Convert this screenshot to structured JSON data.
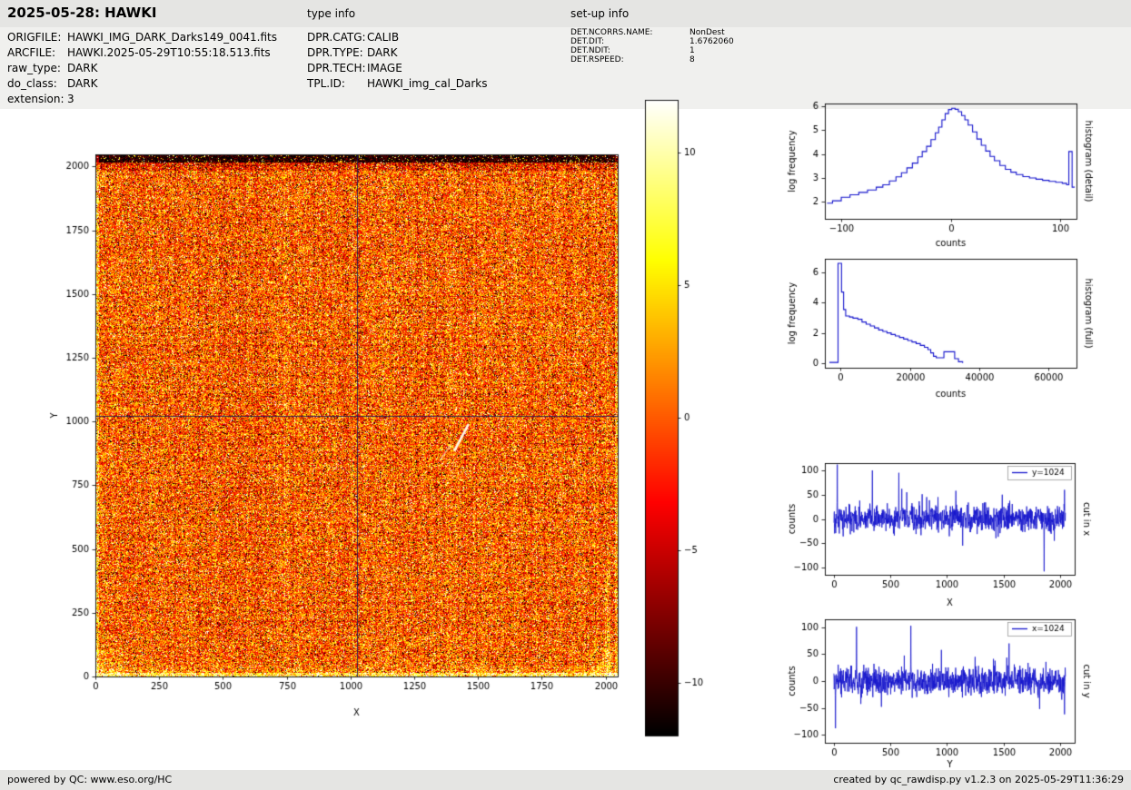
{
  "colors": {
    "page_bg": "#ffffff",
    "band_bg": "#f0f0ee",
    "bar_bg": "#e5e5e3",
    "figure_bg": "#ffffff",
    "plot_line": "#1414cc",
    "crosshair": "#14145a"
  },
  "header": {
    "title": "2025-05-28: HAWKI",
    "type_info_label": "type info",
    "setup_info_label": "set-up info"
  },
  "metadata": {
    "files": [
      {
        "label": "ORIGFILE:",
        "value": "HAWKI_IMG_DARK_Darks149_0041.fits"
      },
      {
        "label": "ARCFILE:",
        "value": "HAWKI.2025-05-29T10:55:18.513.fits"
      },
      {
        "label": "raw_type:",
        "value": "DARK"
      },
      {
        "label": "do_class:",
        "value": "DARK"
      },
      {
        "label": "extension:",
        "value": "3"
      }
    ],
    "dpr": [
      {
        "label": "DPR.CATG:",
        "value": "CALIB"
      },
      {
        "label": "DPR.TYPE:",
        "value": "DARK"
      },
      {
        "label": "DPR.TECH:",
        "value": "IMAGE"
      },
      {
        "label": "TPL.ID:",
        "value": "HAWKI_img_cal_Darks"
      }
    ],
    "det": [
      {
        "label": "DET.NCORRS.NAME:",
        "value": "NonDest"
      },
      {
        "label": "DET.DIT:",
        "value": "1.6762060"
      },
      {
        "label": "DET.NDIT:",
        "value": "1"
      },
      {
        "label": "DET.RSPEED:",
        "value": "8"
      }
    ]
  },
  "footer": {
    "left": "powered by QC: www.eso.org/HC",
    "right": "created by qc_rawdisp.py v1.2.3 on 2025-05-29T11:36:29"
  },
  "chart_data": [
    {
      "type": "heatmap",
      "name": "raw dark frame image",
      "xlabel": "X",
      "ylabel": "Y",
      "xlim": [
        0,
        2048
      ],
      "ylim": [
        0,
        2048
      ],
      "xticks": [
        0,
        250,
        500,
        750,
        1000,
        1250,
        1500,
        1750,
        2000
      ],
      "yticks": [
        0,
        250,
        500,
        750,
        1000,
        1250,
        1500,
        1750,
        2000
      ],
      "colormap": "hot",
      "vmin": -12,
      "vmax": 12,
      "colorbar_ticks": [
        10,
        5,
        0,
        -5,
        -10
      ],
      "crosshair_x": 1024,
      "crosshair_y": 1024,
      "noise_sigma": 4,
      "seed": 1234,
      "description": "2048x2048 HAWKI dark frame: orange mid-level gaussian noise with dense salt-and-pepper outliers, dark band along top edge, bright band along bottom edge, bright left/right edge columns, faint bright diagonal streak near (1440,950), dark cut crosshair lines at x=1024 and y=1024"
    },
    {
      "type": "line",
      "name": "histogram (detail)",
      "style": "steps",
      "xlabel": "counts",
      "ylabel": "log frequency",
      "right_label": "histogram (detail)",
      "xlim": [
        -115,
        115
      ],
      "ylim": [
        1.3,
        6.1
      ],
      "xticks": [
        -100,
        0,
        100
      ],
      "yticks": [
        2,
        3,
        4,
        5,
        6
      ],
      "points": [
        [
          -113,
          1.95
        ],
        [
          -108,
          2.05
        ],
        [
          -100,
          2.2
        ],
        [
          -92,
          2.3
        ],
        [
          -84,
          2.4
        ],
        [
          -76,
          2.5
        ],
        [
          -68,
          2.62
        ],
        [
          -62,
          2.72
        ],
        [
          -56,
          2.88
        ],
        [
          -50,
          3.05
        ],
        [
          -45,
          3.22
        ],
        [
          -40,
          3.42
        ],
        [
          -35,
          3.62
        ],
        [
          -30,
          3.88
        ],
        [
          -26,
          4.1
        ],
        [
          -22,
          4.32
        ],
        [
          -18,
          4.6
        ],
        [
          -14,
          4.88
        ],
        [
          -11,
          5.12
        ],
        [
          -8,
          5.42
        ],
        [
          -5,
          5.68
        ],
        [
          -2,
          5.85
        ],
        [
          1,
          5.9
        ],
        [
          4,
          5.86
        ],
        [
          7,
          5.76
        ],
        [
          10,
          5.6
        ],
        [
          13,
          5.42
        ],
        [
          16,
          5.2
        ],
        [
          20,
          4.92
        ],
        [
          24,
          4.62
        ],
        [
          28,
          4.36
        ],
        [
          32,
          4.12
        ],
        [
          36,
          3.9
        ],
        [
          40,
          3.72
        ],
        [
          45,
          3.52
        ],
        [
          50,
          3.36
        ],
        [
          55,
          3.24
        ],
        [
          60,
          3.14
        ],
        [
          66,
          3.06
        ],
        [
          72,
          3.0
        ],
        [
          78,
          2.95
        ],
        [
          84,
          2.9
        ],
        [
          90,
          2.86
        ],
        [
          96,
          2.82
        ],
        [
          102,
          2.78
        ],
        [
          106,
          2.72
        ],
        [
          108,
          4.1
        ],
        [
          110,
          4.1
        ],
        [
          111,
          2.62
        ],
        [
          113,
          2.6
        ]
      ]
    },
    {
      "type": "line",
      "name": "histogram (full)",
      "style": "steps",
      "xlabel": "counts",
      "ylabel": "log frequency",
      "right_label": "histogram (full)",
      "xlim": [
        -4500,
        68000
      ],
      "ylim": [
        -0.3,
        6.9
      ],
      "xticks": [
        0,
        20000,
        40000,
        60000
      ],
      "yticks": [
        0,
        2,
        4,
        6
      ],
      "points": [
        [
          -3200,
          0.05
        ],
        [
          -700,
          0.05
        ],
        [
          -700,
          6.6
        ],
        [
          300,
          6.6
        ],
        [
          300,
          4.7
        ],
        [
          900,
          4.7
        ],
        [
          900,
          3.55
        ],
        [
          1500,
          3.55
        ],
        [
          1500,
          3.12
        ],
        [
          2600,
          3.05
        ],
        [
          3600,
          2.98
        ],
        [
          5000,
          2.9
        ],
        [
          6200,
          2.72
        ],
        [
          7400,
          2.58
        ],
        [
          8600,
          2.46
        ],
        [
          9800,
          2.33
        ],
        [
          11000,
          2.2
        ],
        [
          12200,
          2.1
        ],
        [
          13400,
          2.0
        ],
        [
          14600,
          1.9
        ],
        [
          15800,
          1.8
        ],
        [
          17000,
          1.7
        ],
        [
          18200,
          1.6
        ],
        [
          19400,
          1.5
        ],
        [
          20600,
          1.4
        ],
        [
          21800,
          1.3
        ],
        [
          23000,
          1.18
        ],
        [
          24200,
          1.05
        ],
        [
          25200,
          0.9
        ],
        [
          26000,
          0.68
        ],
        [
          26800,
          0.46
        ],
        [
          27600,
          0.36
        ],
        [
          29400,
          0.36
        ],
        [
          29800,
          0.76
        ],
        [
          32400,
          0.76
        ],
        [
          32900,
          0.3
        ],
        [
          34000,
          0.1
        ],
        [
          35200,
          0.02
        ]
      ]
    },
    {
      "type": "line",
      "name": "cut in x",
      "style": "noise",
      "legend": "y=1024",
      "xlabel": "X",
      "ylabel": "counts",
      "right_label": "cut in x",
      "xlim": [
        -80,
        2130
      ],
      "ylim": [
        -115,
        115
      ],
      "xticks": [
        0,
        500,
        1000,
        1500,
        2000
      ],
      "yticks": [
        -100,
        -50,
        0,
        50,
        100
      ],
      "noise_sigma": 13,
      "seed": 77,
      "n": 1024,
      "x_max": 2048,
      "spikes": [
        [
          30,
          112
        ],
        [
          340,
          100
        ],
        [
          575,
          95
        ],
        [
          600,
          62
        ],
        [
          645,
          55
        ],
        [
          820,
          45
        ],
        [
          1080,
          58
        ],
        [
          1140,
          -55
        ],
        [
          1490,
          50
        ],
        [
          1860,
          -108
        ],
        [
          1950,
          -45
        ],
        [
          2040,
          60
        ]
      ]
    },
    {
      "type": "line",
      "name": "cut in y",
      "style": "noise",
      "legend": "x=1024",
      "xlabel": "Y",
      "ylabel": "counts",
      "right_label": "cut in y",
      "xlim": [
        -80,
        2130
      ],
      "ylim": [
        -115,
        115
      ],
      "xticks": [
        0,
        500,
        1000,
        1500,
        2000
      ],
      "yticks": [
        -100,
        -50,
        0,
        50,
        100
      ],
      "noise_sigma": 13,
      "seed": 99,
      "n": 1024,
      "x_max": 2048,
      "spikes": [
        [
          15,
          -88
        ],
        [
          200,
          101
        ],
        [
          420,
          -48
        ],
        [
          680,
          103
        ],
        [
          950,
          58
        ],
        [
          1250,
          45
        ],
        [
          1550,
          70
        ],
        [
          1820,
          -52
        ],
        [
          2040,
          -62
        ]
      ]
    }
  ]
}
